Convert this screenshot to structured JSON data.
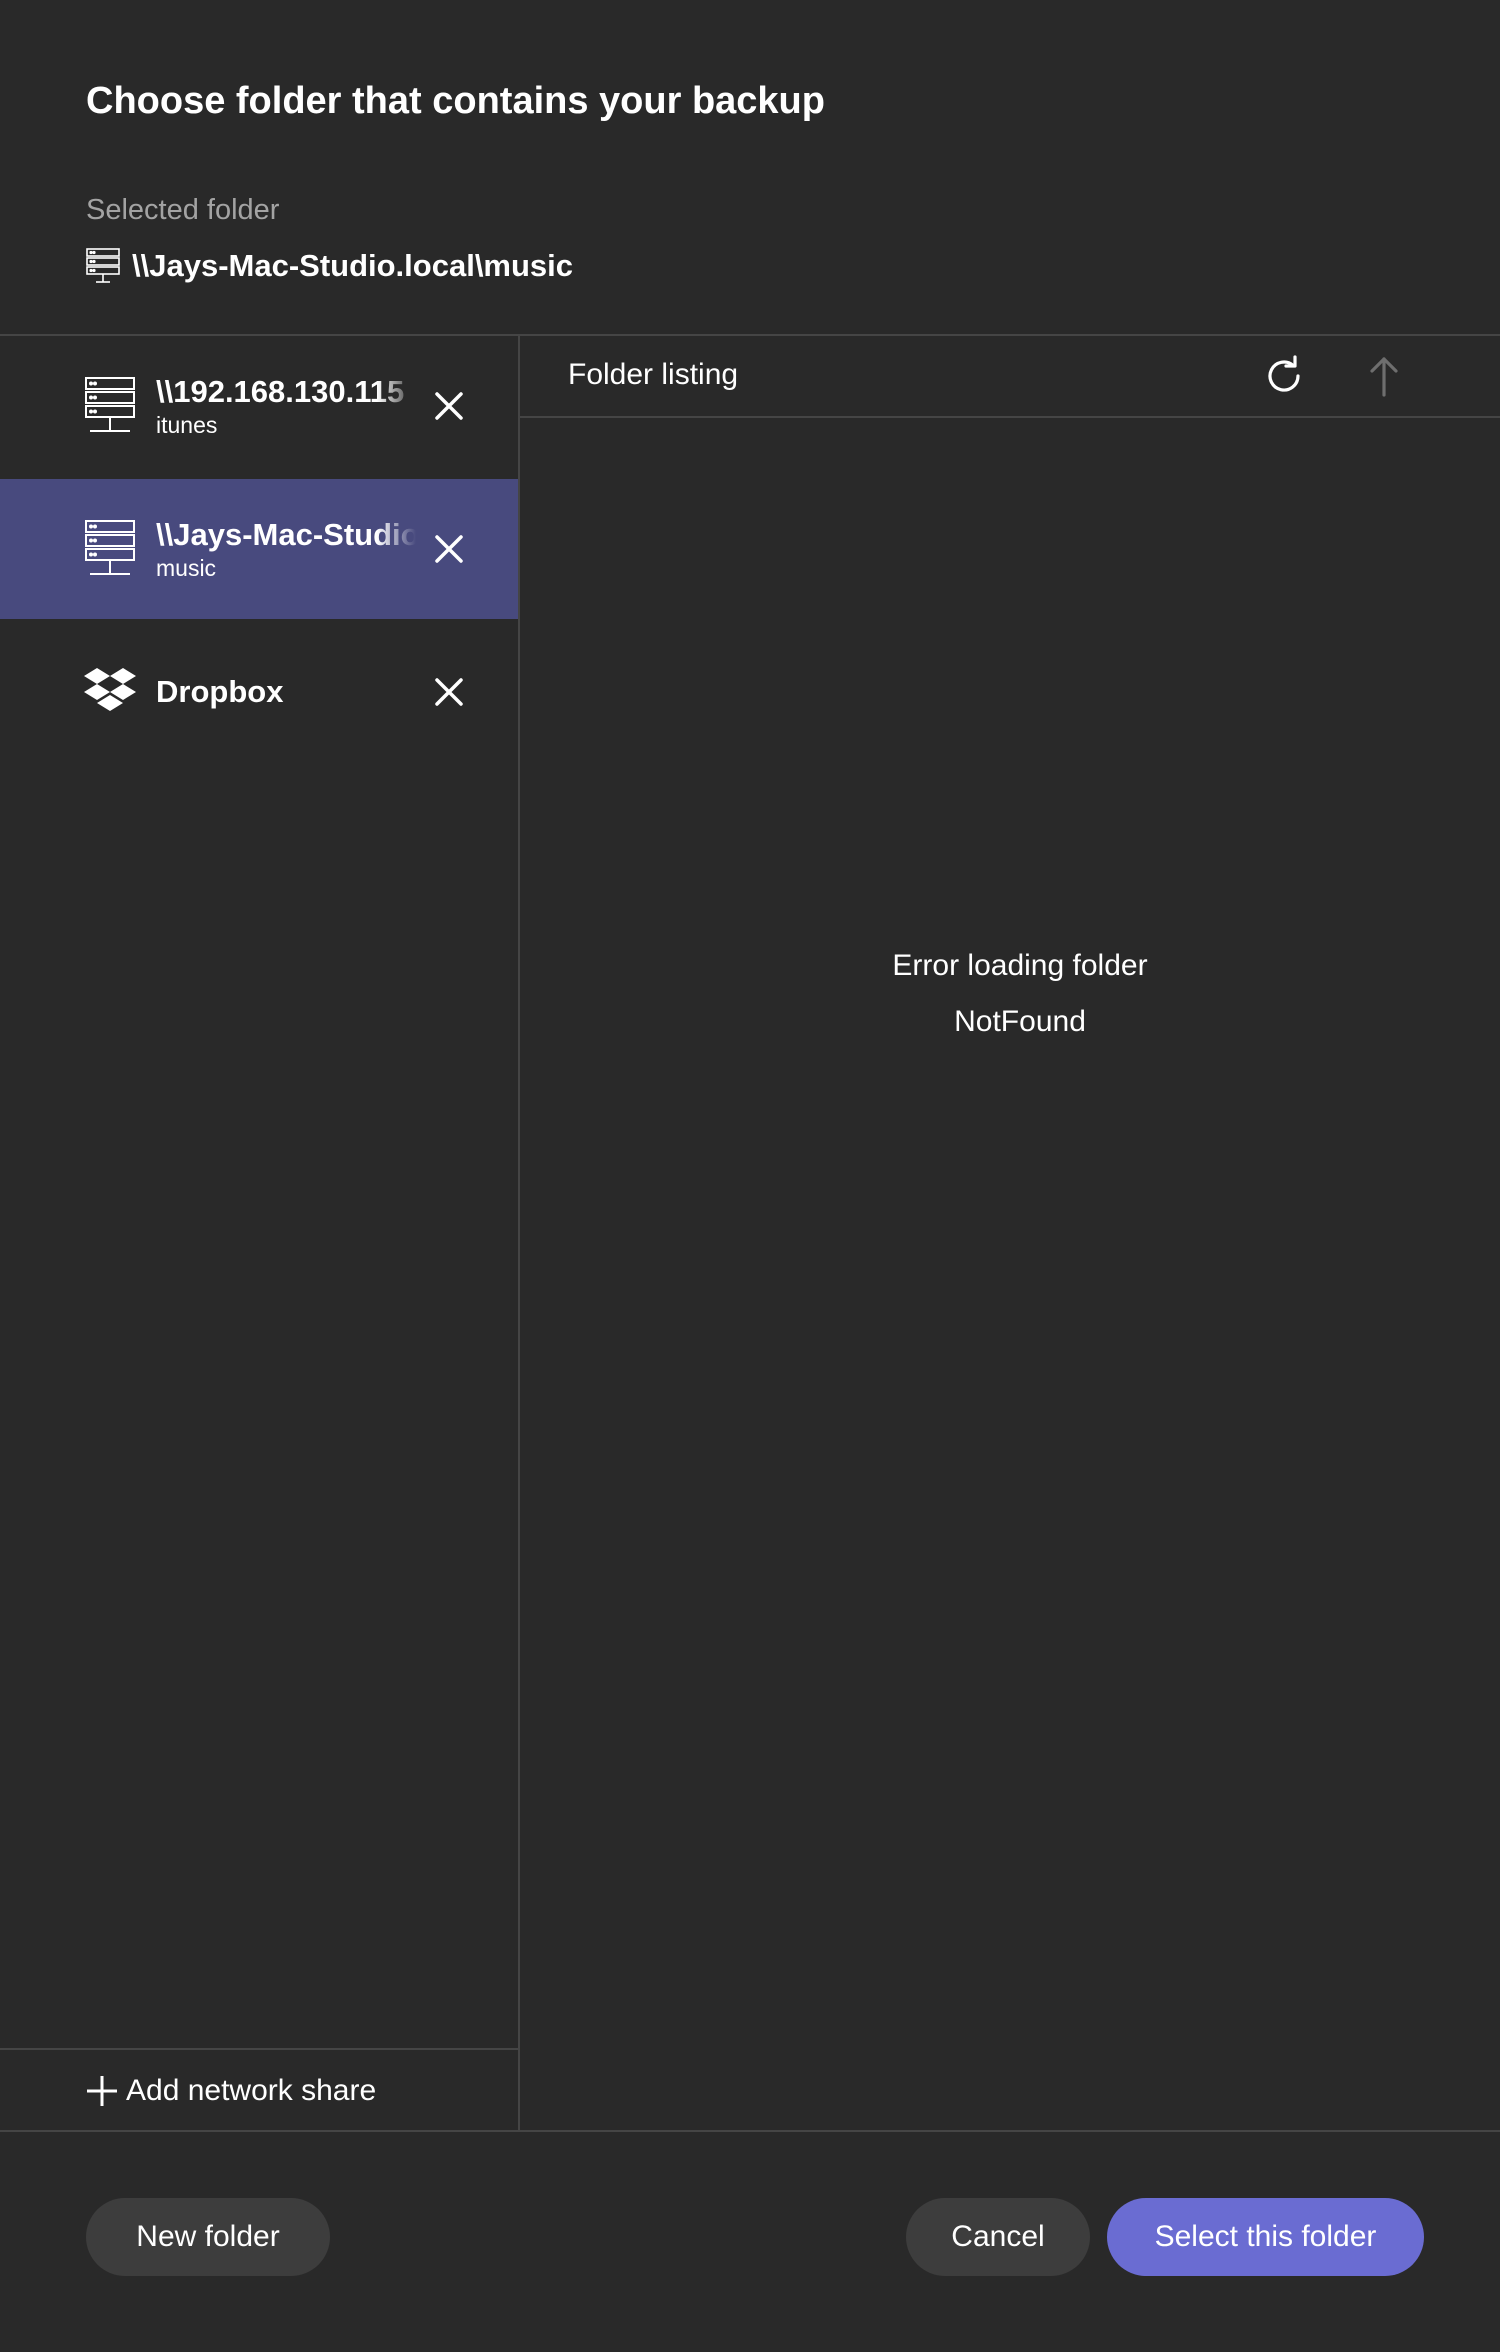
{
  "dialog": {
    "title": "Choose folder that contains your backup",
    "selected_label": "Selected folder",
    "selected_path": "\\\\Jays-Mac-Studio.local\\music",
    "selected_icon": "server-icon"
  },
  "sidebar": {
    "items": [
      {
        "name": "\\\\192.168.130.115",
        "sub": "itunes",
        "icon": "server-icon",
        "active": false
      },
      {
        "name": "\\\\Jays-Mac-Studio.local",
        "sub": "music",
        "icon": "server-icon",
        "active": true
      },
      {
        "name": "Dropbox",
        "sub": "",
        "icon": "dropbox-icon",
        "active": false
      }
    ],
    "add_label": "Add network share"
  },
  "listing": {
    "header": "Folder listing",
    "error_title": "Error loading folder",
    "error_detail": "NotFound"
  },
  "footer": {
    "new_folder": "New folder",
    "cancel": "Cancel",
    "select": "Select this folder"
  },
  "colors": {
    "background": "#292929",
    "active_item": "#484a7e",
    "primary_button": "#6a6cd2",
    "secondary_button": "#3d3d3d",
    "divider": "#454545",
    "muted_text": "#a3a3a3"
  }
}
